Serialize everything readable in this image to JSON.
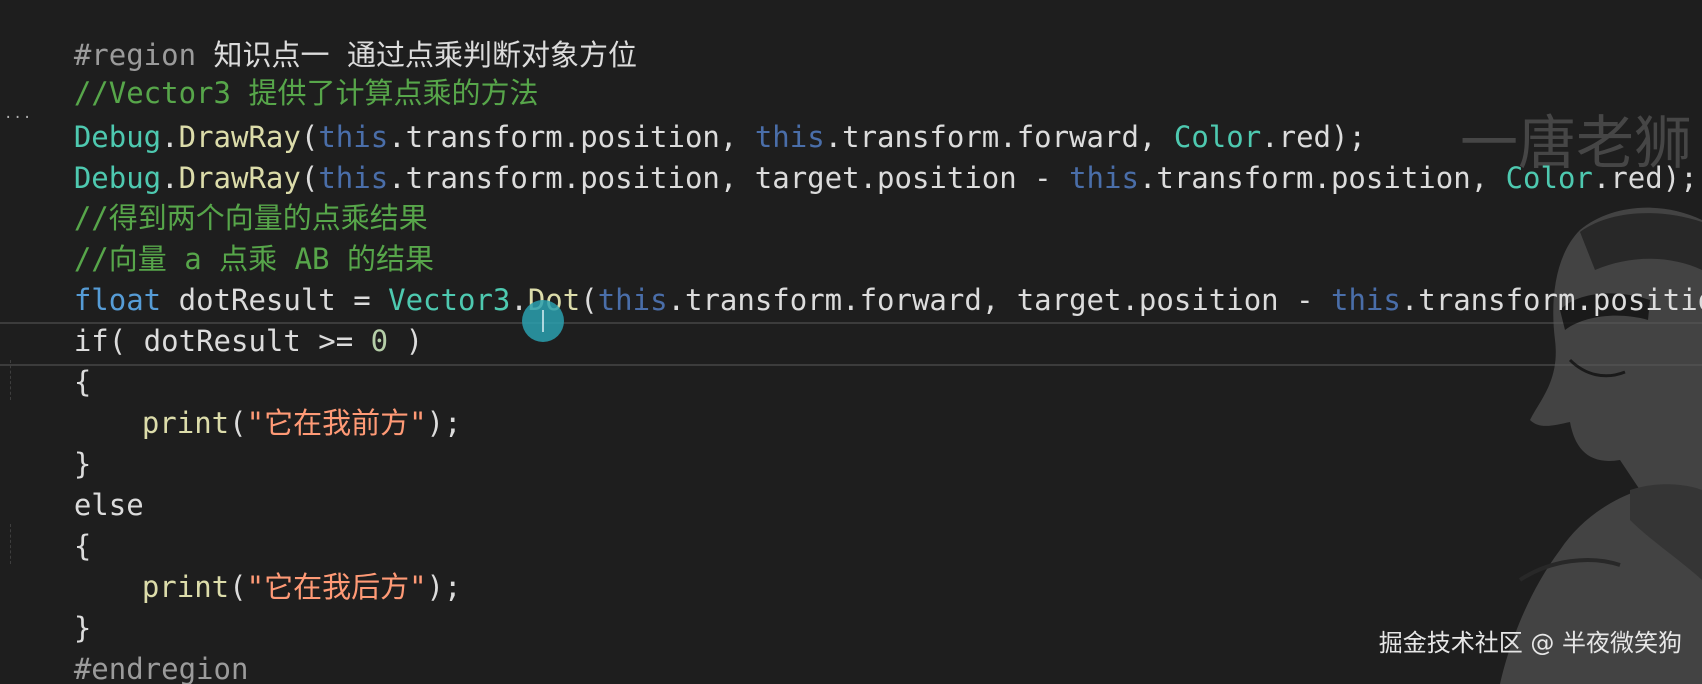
{
  "editor": {
    "lines": {
      "l1": {
        "directive": "#region",
        "title": " 知识点一 通过点乘判断对象方位"
      },
      "l2": {
        "comment": "//Vector3 提供了计算点乘的方法"
      },
      "l3": {
        "debug": "Debug",
        "dot1": ".",
        "drawray": "DrawRay",
        "open": "(",
        "this1": "this",
        "p1": ".transform.position, ",
        "this2": "this",
        "p2": ".transform.forward, ",
        "color": "Color",
        "p3": ".red);"
      },
      "l4": {
        "debug": "Debug",
        "dot1": ".",
        "drawray": "DrawRay",
        "open": "(",
        "this1": "this",
        "p1": ".transform.position, target.position - ",
        "this2": "this",
        "p2": ".transform.position, ",
        "color": "Color",
        "p3": ".red);"
      },
      "l5": {
        "comment": "//得到两个向量的点乘结果"
      },
      "l6": {
        "comment": "//向量 a 点乘 AB 的结果"
      },
      "l7": {
        "kw": "float",
        "p1": " dotResult = ",
        "type": "Vector3",
        "p2": ".",
        "method": "Dot",
        "p3": "(",
        "this1": "this",
        "p4": ".transform.forward, target.position - ",
        "this2": "this",
        "p5": ".transform.position);"
      },
      "l8": {
        "kw": "if",
        "p1": "( dotResult >= ",
        "num": "0",
        "p2": " )"
      },
      "l9": {
        "brace": "{"
      },
      "l10": {
        "method": "print",
        "open": "(",
        "str": "\"它在我前方\"",
        "close": ");"
      },
      "l11": {
        "brace": "}"
      },
      "l12": {
        "kw": "else"
      },
      "l13": {
        "brace": "{"
      },
      "l14": {
        "method": "print",
        "open": "(",
        "str": "\"它在我后方\"",
        "close": ");"
      },
      "l15": {
        "brace": "}"
      },
      "l16": {
        "directive": "#endregion"
      }
    },
    "fold_marker": "...",
    "cursor_icon": "i-beam-cursor-icon"
  },
  "overlay": {
    "watermark_top": "一唐老狮",
    "watermark_bottom": "掘金技术社区 @ 半夜微笑狗"
  },
  "colors": {
    "background": "#1e1e1e",
    "comment": "#57a64a",
    "keyword": "#569cd6",
    "this_keyword": "#4a6ea9",
    "type": "#4ec9b0",
    "method": "#dcdcaa",
    "string": "#ff9a76",
    "cursor_marker": "#2aa0af"
  }
}
